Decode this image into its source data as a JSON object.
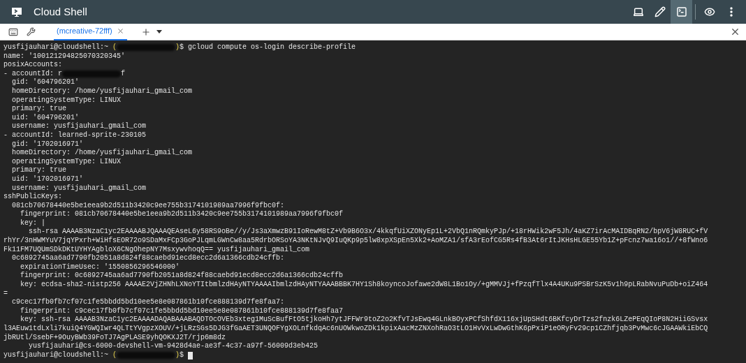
{
  "window": {
    "title": "Cloud Shell"
  },
  "toolbar": [
    {
      "kind": "laptop",
      "selected": false
    },
    {
      "kind": "pencil",
      "selected": false
    },
    {
      "kind": "terminal",
      "selected": true
    },
    {
      "kind": "preview",
      "selected": false
    },
    {
      "kind": "more",
      "selected": false
    }
  ],
  "tabs": [
    {
      "label": "(mcreative-72fff)",
      "selected": true
    }
  ],
  "terminal": {
    "lines": [
      [
        {
          "kind": "text",
          "text": "yusfijauhari@cloudshell:~ "
        },
        {
          "kind": "accent",
          "text": "("
        },
        {
          "kind": "redaction"
        },
        {
          "kind": "accent",
          "text": ")"
        },
        {
          "kind": "text",
          "text": "$ gcloud compute os-login describe-profile"
        }
      ],
      [
        {
          "kind": "text",
          "text": "name: '100121294825070320345'"
        }
      ],
      [
        {
          "kind": "text",
          "text": "posixAccounts:"
        }
      ],
      [
        {
          "kind": "text",
          "text": "- accountId: r"
        },
        {
          "kind": "redaction"
        },
        {
          "kind": "text",
          "text": "f"
        }
      ],
      [
        {
          "kind": "text",
          "text": "  gid: '604796201'"
        }
      ],
      [
        {
          "kind": "text",
          "text": "  homeDirectory: /home/yusfijauhari_gmail_com"
        }
      ],
      [
        {
          "kind": "text",
          "text": "  operatingSystemType: LINUX"
        }
      ],
      [
        {
          "kind": "text",
          "text": "  primary: true"
        }
      ],
      [
        {
          "kind": "text",
          "text": "  uid: '604796201'"
        }
      ],
      [
        {
          "kind": "text",
          "text": "  username: yusfijauhari_gmail_com"
        }
      ],
      [
        {
          "kind": "text",
          "text": "- accountId: learned-sprite-230105"
        }
      ],
      [
        {
          "kind": "text",
          "text": "  gid: '1702016971'"
        }
      ],
      [
        {
          "kind": "text",
          "text": "  homeDirectory: /home/yusfijauhari_gmail_com"
        }
      ],
      [
        {
          "kind": "text",
          "text": "  operatingSystemType: LINUX"
        }
      ],
      [
        {
          "kind": "text",
          "text": "  primary: true"
        }
      ],
      [
        {
          "kind": "text",
          "text": "  uid: '1702016971'"
        }
      ],
      [
        {
          "kind": "text",
          "text": "  username: yusfijauhari_gmail_com"
        }
      ],
      [
        {
          "kind": "text",
          "text": "sshPublicKeys:"
        }
      ],
      [
        {
          "kind": "text",
          "text": "  081cb70678440e5be1eea9b2d511b3420c9ee755b3174101989aa7996f9fbc0f:"
        }
      ],
      [
        {
          "kind": "text",
          "text": "    fingerprint: 081cb70678440e5be1eea9b2d511b3420c9ee755b3174101989aa7996f9fbc0f"
        }
      ],
      [
        {
          "kind": "text",
          "text": "    key: |"
        }
      ],
      [
        {
          "kind": "text",
          "text": "      ssh-rsa AAAAB3NzaC1yc2EAAAABJQAAAQEAseL6y58RS9oBe//y/Js3aXmwzB91IoRewM8tZ+Vb9B6O3x/4kkqfUiXZONyEp1L+2VbQ1nRQmkyPJp/+18rHWik2wF5Jh/4aKZ7irAcMAIDBqRN2/bpV6jW8RUC+fV"
        }
      ],
      [
        {
          "kind": "text",
          "text": "rhYr/3nHWMYuV7jqYPxrh+WiHfsEOR72o9SDaMxFCp3GoPJLqmLGWnCw8aa5RdrbORSoYA3NKtNJvQ9IuQKp9p5lw8xpXSpEn5Xk2+AoMZA1/sfA3rEofCG5Rs4fB3At6rItJKHsHLGE55Yb1Z+pFcnz7wa16o1//+8fWno6"
        }
      ],
      [
        {
          "kind": "text",
          "text": "Fk11FM7UQUmSDkDKtUYHYAgbloX6CNgOhepNY7MsxywvhoqQ== yusfijauhari_gmail_com"
        }
      ],
      [
        {
          "kind": "text",
          "text": "  0c6892745aa6ad7790fb2051a8d824f88caebd91ecd8ecc2d6a1366cdb24cffb:"
        }
      ],
      [
        {
          "kind": "text",
          "text": "    expirationTimeUsec: '1550856296546000'"
        }
      ],
      [
        {
          "kind": "text",
          "text": "    fingerprint: 0c6892745aa6ad7790fb2051a8d824f88caebd91ecd8ecc2d6a1366cdb24cffb"
        }
      ],
      [
        {
          "kind": "text",
          "text": "    key: ecdsa-sha2-nistp256 AAAAE2VjZHNhLXNoYTItbmlzdHAyNTYAAAAIbmlzdHAyNTYAAABBBK7HY1Sh8koyncoJofawe2dW8L1Bo1Oy/+gMMVJj+fPzqfTlx4A4UKu9PSBrSzK5v1h9pLRabNvuPuDb+oiZ464"
        }
      ],
      [
        {
          "kind": "text",
          "text": "="
        }
      ],
      [
        {
          "kind": "text",
          "text": "  c9cec17fb0fb7cf07c1fe5bbdd5bd10ee5e8e087861b10fce888139d7fe8faa7:"
        }
      ],
      [
        {
          "kind": "text",
          "text": "    fingerprint: c9cec17fb0fb7cf07c1fe5bbdd5bd10ee5e8e087861b10fce888139d7fe8faa7"
        }
      ],
      [
        {
          "kind": "text",
          "text": "    key: ssh-rsa AAAAB3NzaC1yc2EAAAADAQABAAABAQDTOcOVEb3xteg1MuScBufFtO5tjkoHh7ytJFFWr9toZ2o2KfvTJsEwq4GLnkBOyxPCfShfdX116xjUpSHdt6BKfcyDrTzs2fnzk6LZePEqQIoP8N2HiiGSvsx"
        }
      ],
      [
        {
          "kind": "text",
          "text": "l3AEuw1tdLxli7kuiQ4YGWQIwr4QLTtYVgpzXOUV/+jLRzSGs5DJG3fGaAET3UNQOFYgXOLnfkdqAc6nUOWkwoZDk1kpixAacMzZNXohRaO3tLO1HvVxLwDwGthK6pPxiP1eORyFv29cp1CZhfjqb3PvMwc6cJGAAWkiEbCQ"
        }
      ],
      [
        {
          "kind": "text",
          "text": "jbRUtl/SsebF+9OuyBWb39FoTJ7AgPLASE9yhQOKXJ2T/rjp6m8dz"
        }
      ],
      [
        {
          "kind": "text",
          "text": "      yusfijauhari@cs-6000-devshell-vm-9428d4ae-ae3f-4c37-a97f-56009d3eb425"
        }
      ],
      [
        {
          "kind": "text",
          "text": "yusfijauhari@cloudshell:~ "
        },
        {
          "kind": "accent",
          "text": "("
        },
        {
          "kind": "redaction"
        },
        {
          "kind": "accent",
          "text": ")"
        },
        {
          "kind": "text",
          "text": "$ "
        },
        {
          "kind": "cursor"
        }
      ]
    ]
  }
}
